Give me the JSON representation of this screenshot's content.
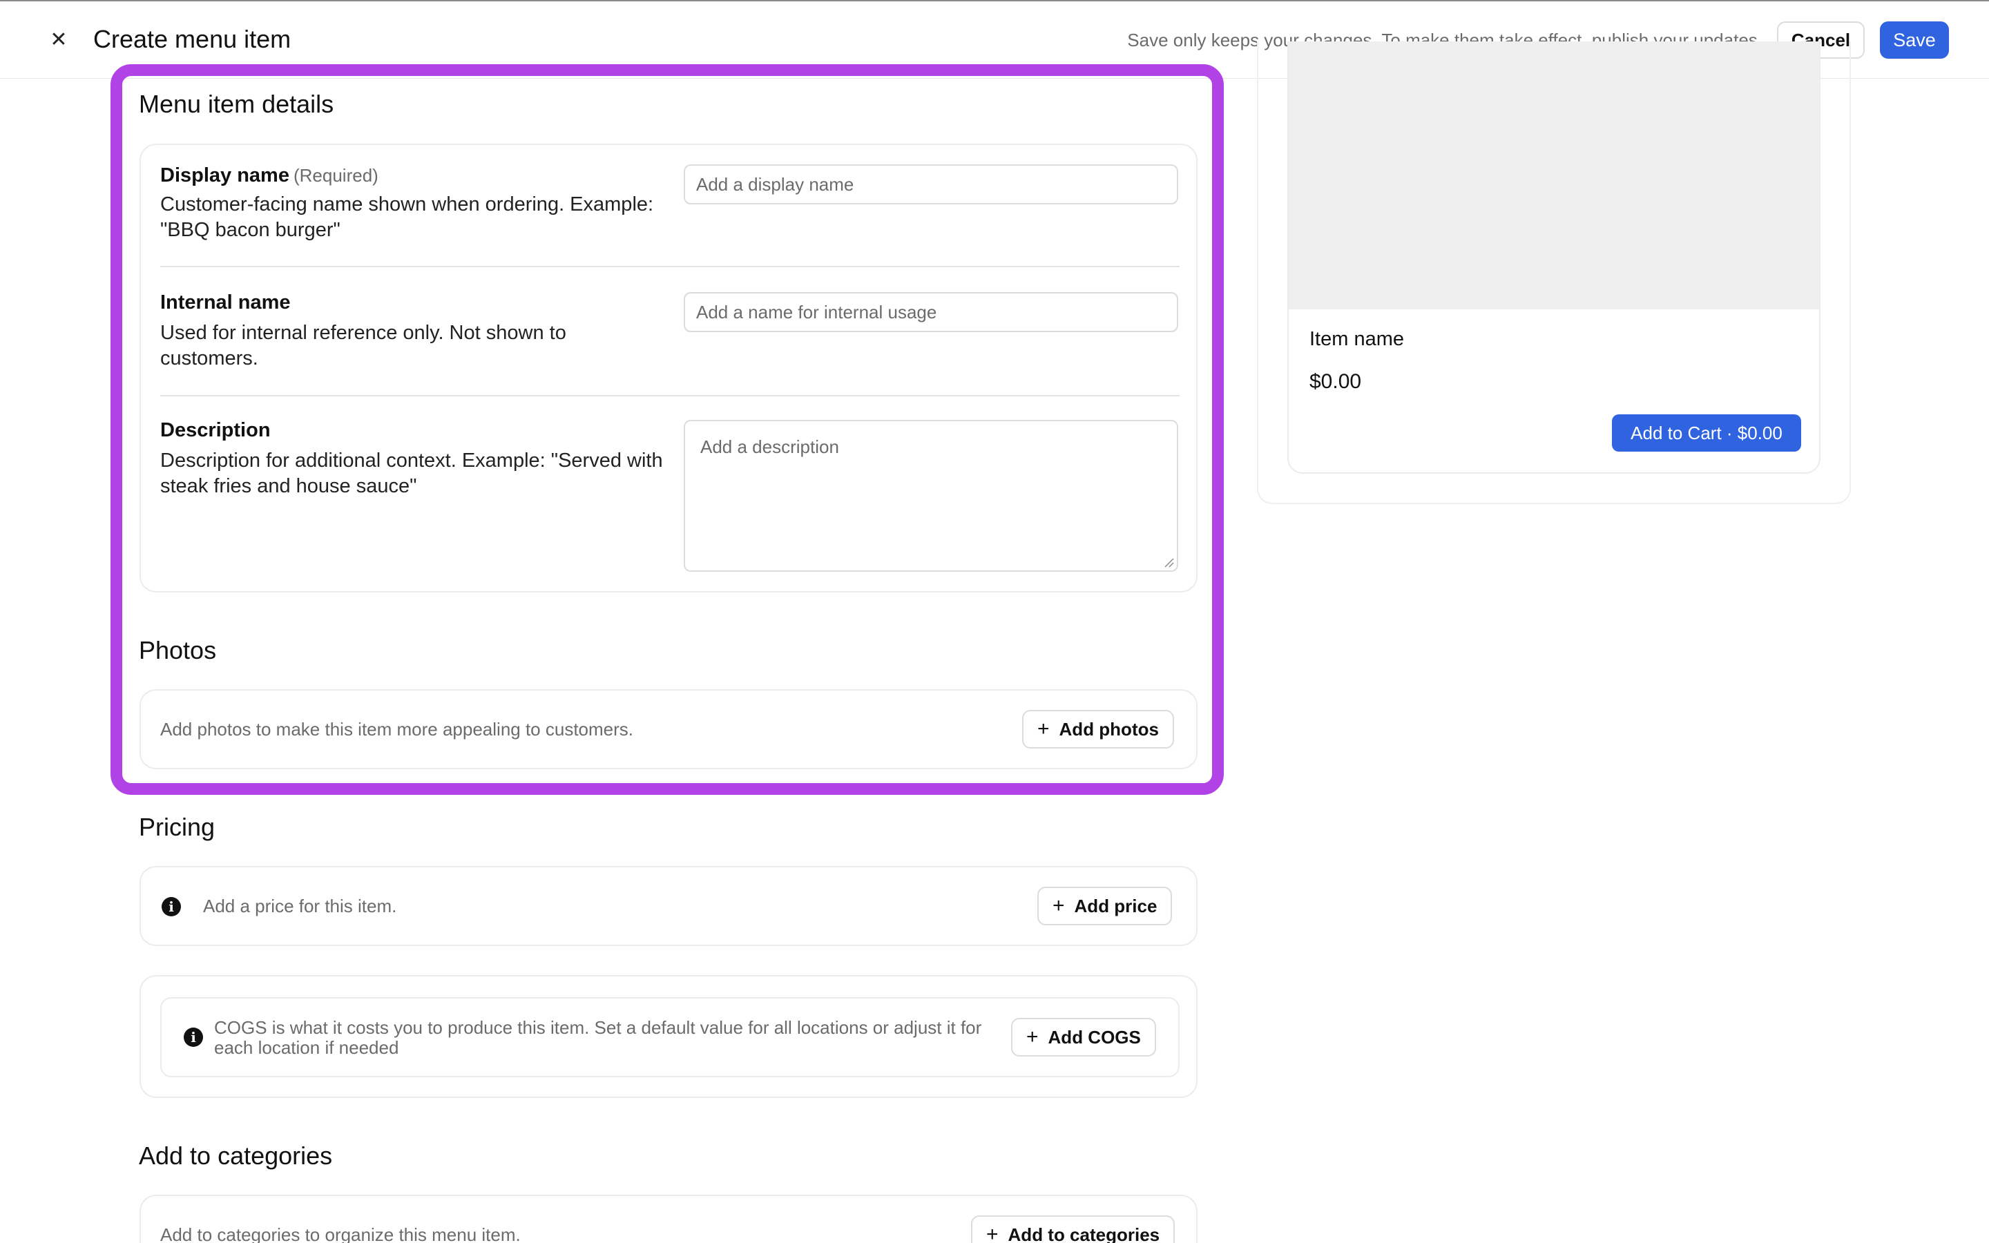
{
  "header": {
    "title": "Create menu item",
    "note": "Save only keeps your changes. To make them take effect, publish your updates.",
    "cancel_label": "Cancel",
    "save_label": "Save"
  },
  "details": {
    "title": "Menu item details",
    "display_name": {
      "label": "Display name",
      "required": "(Required)",
      "help": "Customer-facing name shown when ordering. Example: \"BBQ bacon burger\"",
      "placeholder": "Add a display name"
    },
    "internal_name": {
      "label": "Internal name",
      "help": "Used for internal reference only. Not shown to customers.",
      "placeholder": "Add a name for internal usage"
    },
    "description": {
      "label": "Description",
      "help": "Description for additional context. Example: \"Served with steak fries and house sauce\"",
      "placeholder": "Add a description"
    }
  },
  "photos": {
    "title": "Photos",
    "hint": "Add photos to make this item more appealing to customers.",
    "add_label": "Add photos"
  },
  "pricing": {
    "title": "Pricing",
    "hint": "Add a price for this item.",
    "add_label": "Add price",
    "cogs_text": "COGS is what it costs you to produce this item. Set a default value for all locations or adjust it for each location if needed",
    "cogs_add_label": "Add COGS"
  },
  "categories": {
    "title": "Add to categories",
    "hint": "Add to categories to organize this menu item.",
    "add_label": "Add to categories"
  },
  "preview": {
    "item_name": "Item name",
    "price": "$0.00",
    "cart_label": "Add to Cart · $0.00"
  },
  "colors": {
    "accent": "#2f63e0",
    "highlight": "#b042e6",
    "muted": "#6b6b6b",
    "border": "#ececec"
  },
  "icons": {
    "close": "close-icon",
    "plus": "plus-icon",
    "info": "info-icon"
  }
}
